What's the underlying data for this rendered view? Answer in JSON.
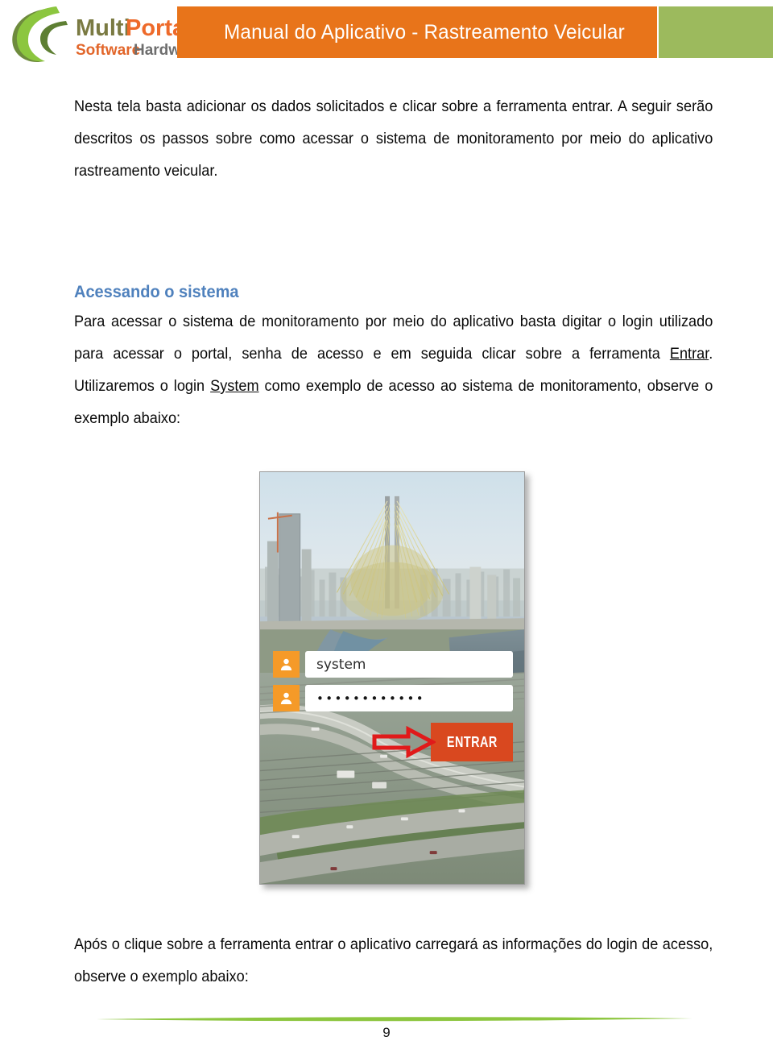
{
  "document": {
    "header": {
      "banner_title": "Manual do Aplicativo - Rastreamento Veicular",
      "banner_color": "#E8741A",
      "accent_block_color": "#9CBA5D",
      "logo": {
        "icon_name": "multi-portal-swoosh-logo",
        "word_one": "Multi",
        "word_two": "Portal",
        "tagline_one": "Software",
        "tagline_two": "Hardware",
        "color_multi": "#7A7A42",
        "color_portal": "#EE6A2A",
        "color_software": "#E2662A",
        "color_hardware": "#6E6E6E",
        "color_swoosh_light": "#8CC63F",
        "color_swoosh_dark": "#6E8B3D"
      }
    },
    "body": {
      "paragraph_1": "Nesta tela basta adicionar os dados solicitados e clicar sobre a ferramenta entrar. A seguir serão descritos os passos sobre como acessar o sistema de monitoramento por meio do aplicativo rastreamento veicular.",
      "section_heading": "Acessando o sistema",
      "section_heading_color": "#4F81BD",
      "paragraph_2_part_1": "Para acessar o sistema de monitoramento por meio do aplicativo basta digitar o login utilizado para acessar o portal, senha de acesso e em seguida clicar sobre a ferramenta ",
      "paragraph_2_link_1": "Entrar",
      "paragraph_2_part_2": ". Utilizaremos o login ",
      "paragraph_2_link_2": "System",
      "paragraph_2_part_3": " como exemplo de acesso ao sistema de monitoramento, observe o exemplo abaixo:",
      "paragraph_3": "Após o clique sobre a ferramenta entrar o aplicativo carregará as informações do login de acesso, observe o exemplo abaixo:"
    },
    "figure": {
      "caption_alt": "Tela de login do aplicativo de rastreamento veicular",
      "background_description": "Vista aérea da Ponte Estaiada Octávio Frias de Oliveira em São Paulo",
      "username_field": {
        "icon_name": "user-icon",
        "value": "system",
        "icon_color": "#F59A28"
      },
      "password_field": {
        "icon_name": "user-icon",
        "value": "••••••••••••",
        "icon_color": "#F59A28"
      },
      "enter_button": {
        "label": "ENTRAR",
        "color": "#D9481F"
      },
      "annotation": {
        "icon_name": "red-arrow-right-icon",
        "color": "#E01A1A"
      }
    },
    "footer": {
      "page_number": "9",
      "rule_color": "#8DC63F"
    }
  }
}
